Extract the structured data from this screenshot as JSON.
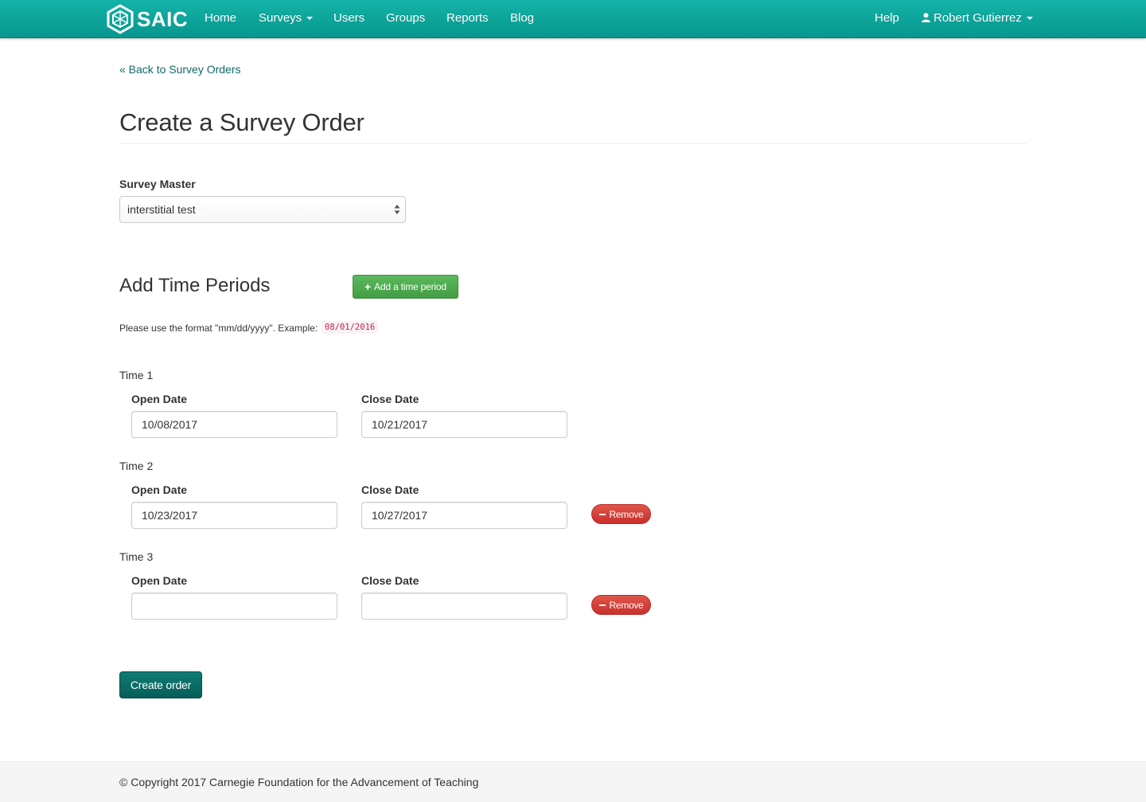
{
  "brand": {
    "name": "SAIC",
    "logo_icon": "hexagon-logo-icon"
  },
  "nav": {
    "home": "Home",
    "surveys": "Surveys",
    "users": "Users",
    "groups": "Groups",
    "reports": "Reports",
    "blog": "Blog",
    "help": "Help",
    "user_name": "Robert Gutierrez"
  },
  "back_link": "« Back to Survey Orders",
  "page_title": "Create a Survey Order",
  "survey_master": {
    "label": "Survey Master",
    "selected": "interstitial test"
  },
  "time_periods": {
    "title": "Add Time Periods",
    "add_button": "Add a time period",
    "help_text": "Please use the format \"mm/dd/yyyy\". Example:",
    "example": "08/01/2016",
    "periods": [
      {
        "label": "Time 1",
        "open_label": "Open Date",
        "close_label": "Close Date",
        "open_value": "10/08/2017",
        "close_value": "10/21/2017"
      },
      {
        "label": "Time 2",
        "open_label": "Open Date",
        "close_label": "Close Date",
        "open_value": "10/23/2017",
        "close_value": "10/27/2017",
        "remove_label": "Remove"
      },
      {
        "label": "Time 3",
        "open_label": "Open Date",
        "close_label": "Close Date",
        "open_value": "",
        "close_value": "",
        "remove_label": "Remove"
      }
    ]
  },
  "create_button": "Create order",
  "footer": "© Copyright 2017 Carnegie Foundation for the Advancement of Teaching",
  "colors": {
    "navbar": "#0aa59b",
    "link": "#0d6b66",
    "add_button": "#5cb85c",
    "remove_button": "#d9534f",
    "create_button": "#0a6d67"
  }
}
